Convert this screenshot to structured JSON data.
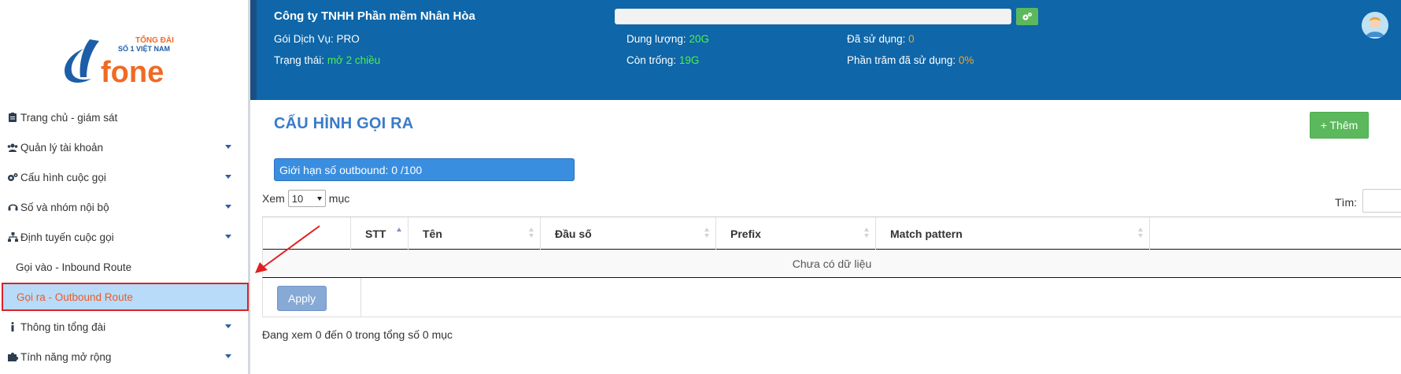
{
  "sidebar": {
    "logo": {
      "tagline_line1": "TỔNG ĐÀI",
      "tagline_line2": "SỐ 1 VIỆT NAM",
      "brand": "fone"
    },
    "items": [
      {
        "label": "Trang chủ - giám sát",
        "icon": "clipboard-icon",
        "has_caret": false
      },
      {
        "label": "Quản lý tài khoản",
        "icon": "users-icon",
        "has_caret": true
      },
      {
        "label": "Cấu hình cuộc gọi",
        "icon": "gears-icon",
        "has_caret": true
      },
      {
        "label": "Số và nhóm nội bộ",
        "icon": "headset-icon",
        "has_caret": true
      },
      {
        "label": "Định tuyến cuộc gọi",
        "icon": "sitemap-icon",
        "has_caret": true
      },
      {
        "label": "Gọi vào - Inbound Route",
        "sub": true
      },
      {
        "label": "Gọi ra - Outbound Route",
        "sub": true,
        "active": true
      },
      {
        "label": "Thông tin tổng đài",
        "icon": "info-icon",
        "has_caret": true
      },
      {
        "label": "Tính năng mở rộng",
        "icon": "puzzle-icon",
        "has_caret": true
      }
    ]
  },
  "header": {
    "company": "Công ty TNHH Phần mềm Nhân Hòa",
    "service_label": "Gói Dịch Vụ:",
    "service_value": "PRO",
    "status_label": "Trạng thái:",
    "status_value": "mở 2 chiều",
    "capacity_label": "Dung lượng:",
    "capacity_value": "20G",
    "free_label": "Còn trống:",
    "free_value": "19G",
    "used_label": "Đã sử dụng:",
    "used_value": "0",
    "percent_label": "Phần trăm đã sử dụng:",
    "percent_value": "0%"
  },
  "main": {
    "title": "CẤU HÌNH GỌI RA",
    "add_button": "+ Thêm",
    "limit_text": "Giới hạn số outbound:  0  /100",
    "length_prefix": "Xem",
    "length_value": "10",
    "length_suffix": "mục",
    "search_label": "Tìm:",
    "columns": [
      "",
      "STT",
      "Tên",
      "Đầu số",
      "Prefix",
      "Match pattern",
      ""
    ],
    "empty_text": "Chưa có dữ liệu",
    "apply_button": "Apply",
    "info_text": "Đang xem 0 đến 0 trong tổng số 0 mục"
  },
  "colors": {
    "header_bg": "#0f66a8",
    "accent_green": "#5cb85c",
    "active_bg": "#b8dbf9",
    "active_border": "#d9222a",
    "active_text": "#ee5a24",
    "value_green": "#4df04d",
    "value_orange": "#f5a623"
  }
}
